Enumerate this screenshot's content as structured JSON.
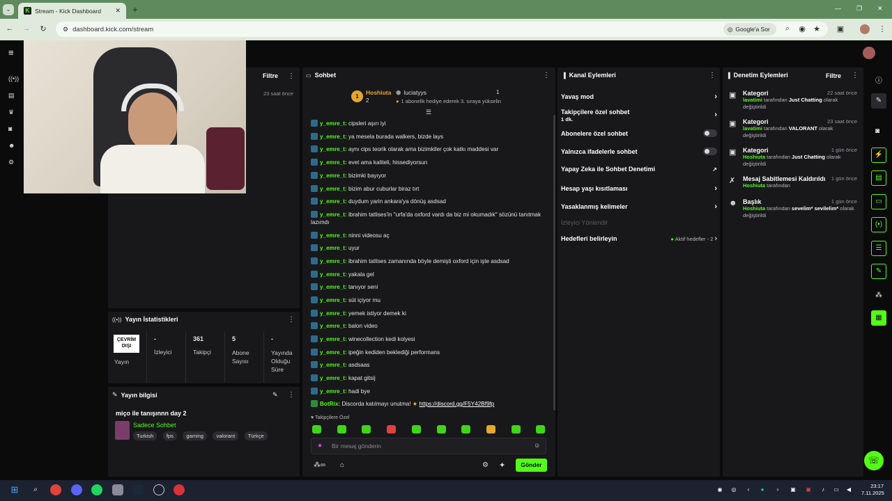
{
  "browser": {
    "tab_title": "Stream - Kick Dashboard",
    "tab_favicon": "K",
    "new_tab": "+",
    "url": "dashboard.kick.com/stream",
    "google_btn": "Google'a Sor",
    "window_min": "—",
    "window_max": "❐",
    "window_close": "✕"
  },
  "stream_panel": {
    "filter_label": "Filtre",
    "time": "23 saat önce"
  },
  "stats": {
    "title": "Yayın İstatistikleri",
    "status": "ÇEVRİM DIŞI",
    "status_label": "Yayın",
    "items": [
      {
        "value": "-",
        "label": "İzleyici"
      },
      {
        "value": "361",
        "label": "Takipçi"
      },
      {
        "value": "5",
        "label": "Abone Sayısı"
      },
      {
        "value": "-",
        "label": "Yayında Olduğu Süre"
      }
    ]
  },
  "info": {
    "title": "Yayın bilgisi",
    "stream_title": "miço ile tanışınnn day 2",
    "category": "Sadece Sohbet",
    "tags": [
      "Turkish",
      "fps",
      "gaming",
      "valorant",
      "Türkçe"
    ]
  },
  "chat": {
    "title": "Sohbet",
    "pinned_user1": "Hoshiuta",
    "pinned_count1": "2",
    "pinned_user2": "luciatyys",
    "pinned_count2": "1",
    "pinned_msg": "1 abonelik hediye ederek 3. sıraya yükselin",
    "rank": "1",
    "messages": [
      {
        "user": "y_emre_t:",
        "text": "cipsleri aşırı iyi"
      },
      {
        "user": "y_emre_t:",
        "text": "ya mesela burada walkers, bizde lays"
      },
      {
        "user": "y_emre_t:",
        "text": "aynı cips teorik olarak ama bizimkiler çok katkı maddesi var"
      },
      {
        "user": "y_emre_t:",
        "text": "evet ama kaliteli, hissediyorsun"
      },
      {
        "user": "y_emre_t:",
        "text": "bizimki bayıyor"
      },
      {
        "user": "y_emre_t:",
        "text": "bizim abur cuburlar biraz tırt"
      },
      {
        "user": "y_emre_t:",
        "text": "duydum yarin ankara'ya dönüş asdsad"
      },
      {
        "user": "y_emre_t:",
        "text": "ibrahim tatlises'in \"urfa'da oxford vardı da biz mi okumadık\" sözünü tanıtmak lazımdı"
      },
      {
        "user": "y_emre_t:",
        "text": "ninni videosu aç"
      },
      {
        "user": "y_emre_t:",
        "text": "uyur"
      },
      {
        "user": "y_emre_t:",
        "text": "ibrahim tatlises zamanında böyle demişti oxford için işte asdsad"
      },
      {
        "user": "y_emre_t:",
        "text": "yakala gel"
      },
      {
        "user": "y_emre_t:",
        "text": "tanıyor seni"
      },
      {
        "user": "y_emre_t:",
        "text": "süt içiyor mu"
      },
      {
        "user": "y_emre_t:",
        "text": "yemek istiyor demek ki"
      },
      {
        "user": "y_emre_t:",
        "text": "balon video"
      },
      {
        "user": "y_emre_t:",
        "text": "winecollection kedi kolyesi"
      },
      {
        "user": "y_emre_t:",
        "text": "ipeğin kediden beklediği performans"
      },
      {
        "user": "y_emre_t:",
        "text": "asdsaas"
      },
      {
        "user": "y_emre_t:",
        "text": "kapat gitsij"
      },
      {
        "user": "y_emre_t:",
        "text": "hadi bye"
      }
    ],
    "bot_user": "BotRix:",
    "bot_text": "Discorda katılmayı unutma!",
    "bot_link": "https://discord.gg/F5Y42Bf9fp",
    "followers_only": "Takipçilere Özel",
    "placeholder": "Bir mesaj gönderin",
    "send": "Gönder"
  },
  "channel": {
    "title": "Kanal Eylemleri",
    "slow": "Yavaş mod",
    "followers_chat": "Takipçilere özel sohbet",
    "followers_chat_sub": "1 dk.",
    "subs_chat": "Abonelere özel sohbet",
    "emote_chat": "Yalnızca ifadelerle sohbet",
    "ai": "Yapay Zeka ile Sohbet Denetimi",
    "age": "Hesap yaşı kısıtlaması",
    "banned": "Yasaklanmış kelimeler",
    "raid": "İzleyici Yönlendir",
    "goals": "Hedefleri belirleyin",
    "goals_status": "Aktif hedefler - 2"
  },
  "moderation": {
    "title": "Denetim Eylemleri",
    "filter_label": "Filtre",
    "items": [
      {
        "title": "Kategori",
        "time": "22 saat önce",
        "user": "lavatimi",
        "mid": " tarafından ",
        "target": "Just Chatting",
        "end": " olarak değiştirildi"
      },
      {
        "title": "Kategori",
        "time": "23 saat önce",
        "user": "lavatimi",
        "mid": " tarafından ",
        "target": "VALORANT",
        "end": " olarak değiştirildi"
      },
      {
        "title": "Kategori",
        "time": "1 gün önce",
        "user": "Hoshiuta",
        "mid": " tarafından ",
        "target": "Just Chatting",
        "end": " olarak değiştirildi"
      },
      {
        "title": "Mesaj Sabitlemesi Kaldırıldı",
        "time": "1 gün önce",
        "user": "Hoshiuta",
        "mid": " tarafından",
        "target": "",
        "end": ""
      },
      {
        "title": "Başlık",
        "time": "1 gün önce",
        "user": "Hoshiuta",
        "mid": " tarafından ",
        "target": "sevelim* sevilelim*",
        "end": " olarak değiştirildi"
      }
    ]
  },
  "taskbar": {
    "time": "23:17",
    "date": "7.11.2025"
  },
  "colors": {
    "accent": "#53fc18",
    "panel": "#18181b",
    "bg": "#0b0b0c"
  }
}
